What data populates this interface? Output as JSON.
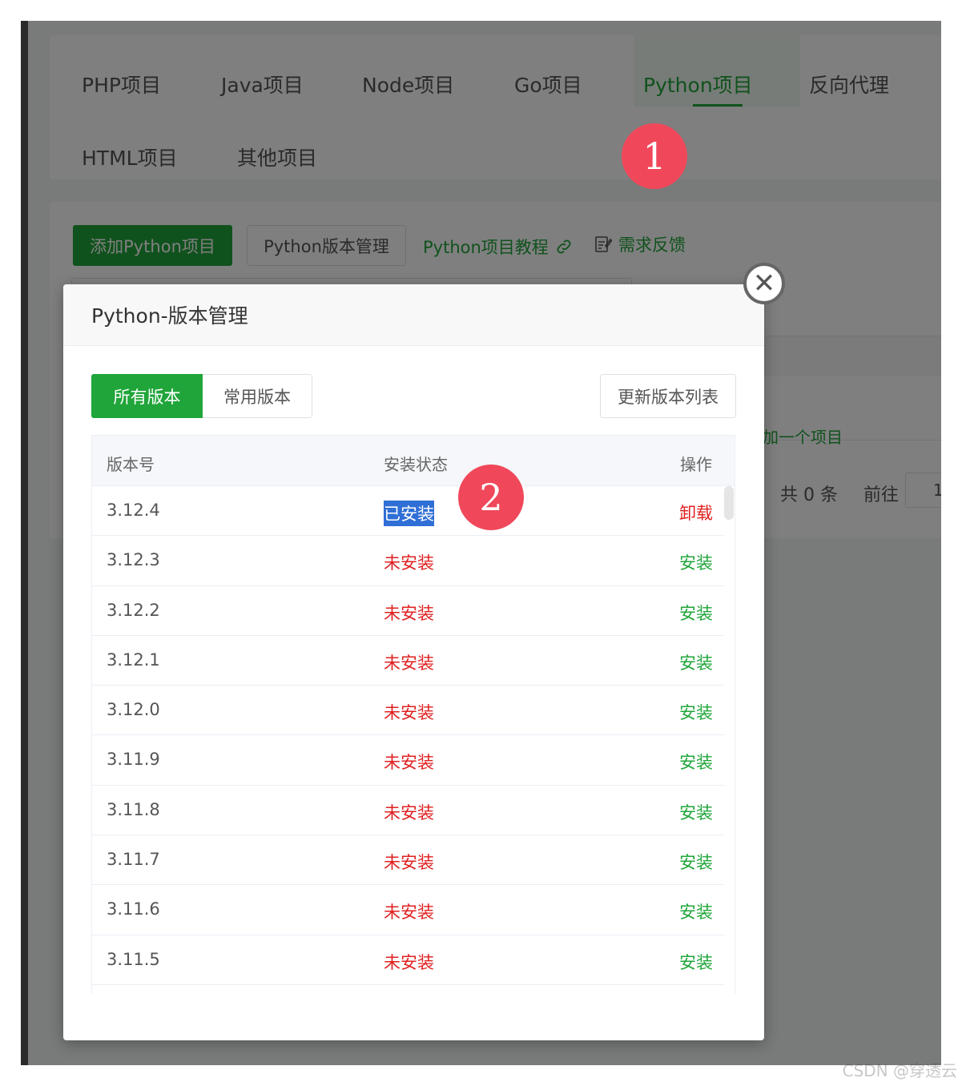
{
  "tabs": [
    {
      "label": "PHP项目"
    },
    {
      "label": "Java项目"
    },
    {
      "label": "Node项目"
    },
    {
      "label": "Go项目"
    },
    {
      "label": "Python项目",
      "active": true
    },
    {
      "label": "反向代理"
    },
    {
      "label": "HTML项目"
    },
    {
      "label": "其他项目"
    }
  ],
  "toolbar": {
    "add_label": "添加Python项目",
    "version_label": "Python版本管理",
    "tutorial_label": "Python项目教程",
    "feedback_label": "需求反馈"
  },
  "background": {
    "add_link": "加一个项目",
    "total": "共 0 条",
    "goto": "前往",
    "page": "1"
  },
  "modal": {
    "title": "Python-版本管理",
    "seg_all": "所有版本",
    "seg_common": "常用版本",
    "refresh_label": "更新版本列表",
    "columns": {
      "version": "版本号",
      "status": "安装状态",
      "op": "操作"
    },
    "rows": [
      {
        "version": "3.12.4",
        "status": "已安装",
        "op": "卸载"
      },
      {
        "version": "3.12.3",
        "status": "未安装",
        "op": "安装"
      },
      {
        "version": "3.12.2",
        "status": "未安装",
        "op": "安装"
      },
      {
        "version": "3.12.1",
        "status": "未安装",
        "op": "安装"
      },
      {
        "version": "3.12.0",
        "status": "未安装",
        "op": "安装"
      },
      {
        "version": "3.11.9",
        "status": "未安装",
        "op": "安装"
      },
      {
        "version": "3.11.8",
        "status": "未安装",
        "op": "安装"
      },
      {
        "version": "3.11.7",
        "status": "未安装",
        "op": "安装"
      },
      {
        "version": "3.11.6",
        "status": "未安装",
        "op": "安装"
      },
      {
        "version": "3.11.5",
        "status": "未安装",
        "op": "安装"
      }
    ]
  },
  "markers": {
    "one": "1",
    "two": "2"
  },
  "watermark": "CSDN @穿透云",
  "colors": {
    "accent": "#20a53a",
    "danger": "#e02020",
    "marker": "#f0485a",
    "selection": "#2f6fd6"
  },
  "icons": {
    "close": "close-icon",
    "link": "link-icon",
    "feedback": "edit-icon"
  }
}
